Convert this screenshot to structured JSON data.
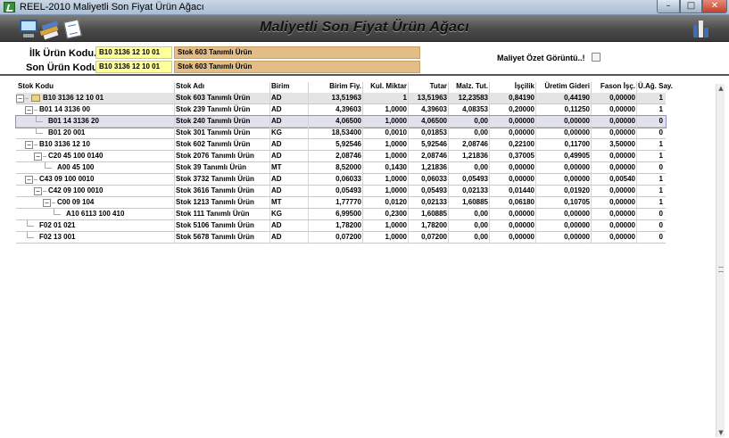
{
  "window": {
    "title": "REEL-2010 Maliyetli Son Fiyat Ürün Ağacı",
    "minimize": "–",
    "maximize": "□",
    "close": "✕"
  },
  "header": {
    "heading": "Maliyetli Son Fiyat Ürün Ağacı",
    "icons": [
      "computer-icon",
      "books-icon",
      "paper-icon",
      "chart-icon"
    ]
  },
  "params": {
    "first_label": "İlk Ürün Kodu.:",
    "first_code": "B10 3136 12 10 01",
    "first_name": "Stok 603 Tanımlı Ürün",
    "last_label": "Son Ürün Kodu.:",
    "last_code": "B10 3136 12 10 01",
    "last_name": "Stok 603 Tanımlı Ürün",
    "summary_label": "Maliyet Özet Görüntü..!",
    "summary_checked": false
  },
  "grid": {
    "columns": [
      "Stok Kodu",
      "Stok Adı",
      "Birim",
      "Birim Fiy.",
      "Kul. Miktar",
      "Tutar",
      "Malz. Tut.",
      "İşçilik",
      "Üretim Gideri",
      "Fason İşç.",
      "Ü.Ağ. Say."
    ],
    "rows": [
      {
        "level": 0,
        "kind": "root",
        "code": "B10 3136 12 10 01",
        "name": "Stok 603 Tanımlı Ürün",
        "unit": "AD",
        "price": "13,51963",
        "qty": "1",
        "total": "13,51963",
        "material": "12,23583",
        "labor": "0,84190",
        "overhead": "0,44190",
        "outsource": "0,00000",
        "count": "1"
      },
      {
        "level": 1,
        "kind": "branch",
        "code": "B01 14 3136 00",
        "name": "Stok 239 Tanımlı Ürün",
        "unit": "AD",
        "price": "4,39603",
        "qty": "1,0000",
        "total": "4,39603",
        "material": "4,08353",
        "labor": "0,20000",
        "overhead": "0,11250",
        "outsource": "0,00000",
        "count": "1"
      },
      {
        "level": 2,
        "kind": "selected",
        "code": "B01 14 3136 20",
        "name": "Stok 240 Tanımlı Ürün",
        "unit": "AD",
        "price": "4,06500",
        "qty": "1,0000",
        "total": "4,06500",
        "material": "0,00",
        "labor": "0,00000",
        "overhead": "0,00000",
        "outsource": "0,00000",
        "count": "0"
      },
      {
        "level": 2,
        "kind": "leaf",
        "code": "B01 20 001",
        "name": "Stok 301 Tanımlı Ürün",
        "unit": "KG",
        "price": "18,53400",
        "qty": "0,0010",
        "total": "0,01853",
        "material": "0,00",
        "labor": "0,00000",
        "overhead": "0,00000",
        "outsource": "0,00000",
        "count": "0"
      },
      {
        "level": 1,
        "kind": "branch",
        "code": "B10 3136 12 10",
        "name": "Stok 602 Tanımlı Ürün",
        "unit": "AD",
        "price": "5,92546",
        "qty": "1,0000",
        "total": "5,92546",
        "material": "2,08746",
        "labor": "0,22100",
        "overhead": "0,11700",
        "outsource": "3,50000",
        "count": "1"
      },
      {
        "level": 2,
        "kind": "branch",
        "code": "C20 45 100 0140",
        "name": "Stok 2076 Tanımlı Ürün",
        "unit": "AD",
        "price": "2,08746",
        "qty": "1,0000",
        "total": "2,08746",
        "material": "1,21836",
        "labor": "0,37005",
        "overhead": "0,49905",
        "outsource": "0,00000",
        "count": "1"
      },
      {
        "level": 3,
        "kind": "leaf",
        "code": "A00 45 100",
        "name": "Stok 39 Tanımlı Ürün",
        "unit": "MT",
        "price": "8,52000",
        "qty": "0,1430",
        "total": "1,21836",
        "material": "0,00",
        "labor": "0,00000",
        "overhead": "0,00000",
        "outsource": "0,00000",
        "count": "0"
      },
      {
        "level": 1,
        "kind": "branch",
        "code": "C43 09 100 0010",
        "name": "Stok 3732 Tanımlı Ürün",
        "unit": "AD",
        "price": "0,06033",
        "qty": "1,0000",
        "total": "0,06033",
        "material": "0,05493",
        "labor": "0,00000",
        "overhead": "0,00000",
        "outsource": "0,00540",
        "count": "1"
      },
      {
        "level": 2,
        "kind": "branch",
        "code": "C42 09 100 0010",
        "name": "Stok 3616 Tanımlı Ürün",
        "unit": "AD",
        "price": "0,05493",
        "qty": "1,0000",
        "total": "0,05493",
        "material": "0,02133",
        "labor": "0,01440",
        "overhead": "0,01920",
        "outsource": "0,00000",
        "count": "1"
      },
      {
        "level": 3,
        "kind": "branch",
        "code": "C00 09 104",
        "name": "Stok 1213 Tanımlı Ürün",
        "unit": "MT",
        "price": "1,77770",
        "qty": "0,0120",
        "total": "0,02133",
        "material": "1,60885",
        "labor": "0,06180",
        "overhead": "0,10705",
        "outsource": "0,00000",
        "count": "1"
      },
      {
        "level": 4,
        "kind": "leaf",
        "code": "A10 6113 100 410",
        "name": "Stok 111 Tanımlı Ürün",
        "unit": "KG",
        "price": "6,99500",
        "qty": "0,2300",
        "total": "1,60885",
        "material": "0,00",
        "labor": "0,00000",
        "overhead": "0,00000",
        "outsource": "0,00000",
        "count": "0"
      },
      {
        "level": 1,
        "kind": "leaf",
        "code": "F02 01 021",
        "name": "Stok 5106 Tanımlı Ürün",
        "unit": "AD",
        "price": "1,78200",
        "qty": "1,0000",
        "total": "1,78200",
        "material": "0,00",
        "labor": "0,00000",
        "overhead": "0,00000",
        "outsource": "0,00000",
        "count": "0"
      },
      {
        "level": 1,
        "kind": "leaf",
        "code": "F02 13 001",
        "name": "Stok 5678 Tanımlı Ürün",
        "unit": "AD",
        "price": "0,07200",
        "qty": "1,0000",
        "total": "0,07200",
        "material": "0,00",
        "labor": "0,00000",
        "overhead": "0,00000",
        "outsource": "0,00000",
        "count": "0"
      }
    ]
  },
  "scrollbar": {
    "up": "▲",
    "down": "▼"
  }
}
